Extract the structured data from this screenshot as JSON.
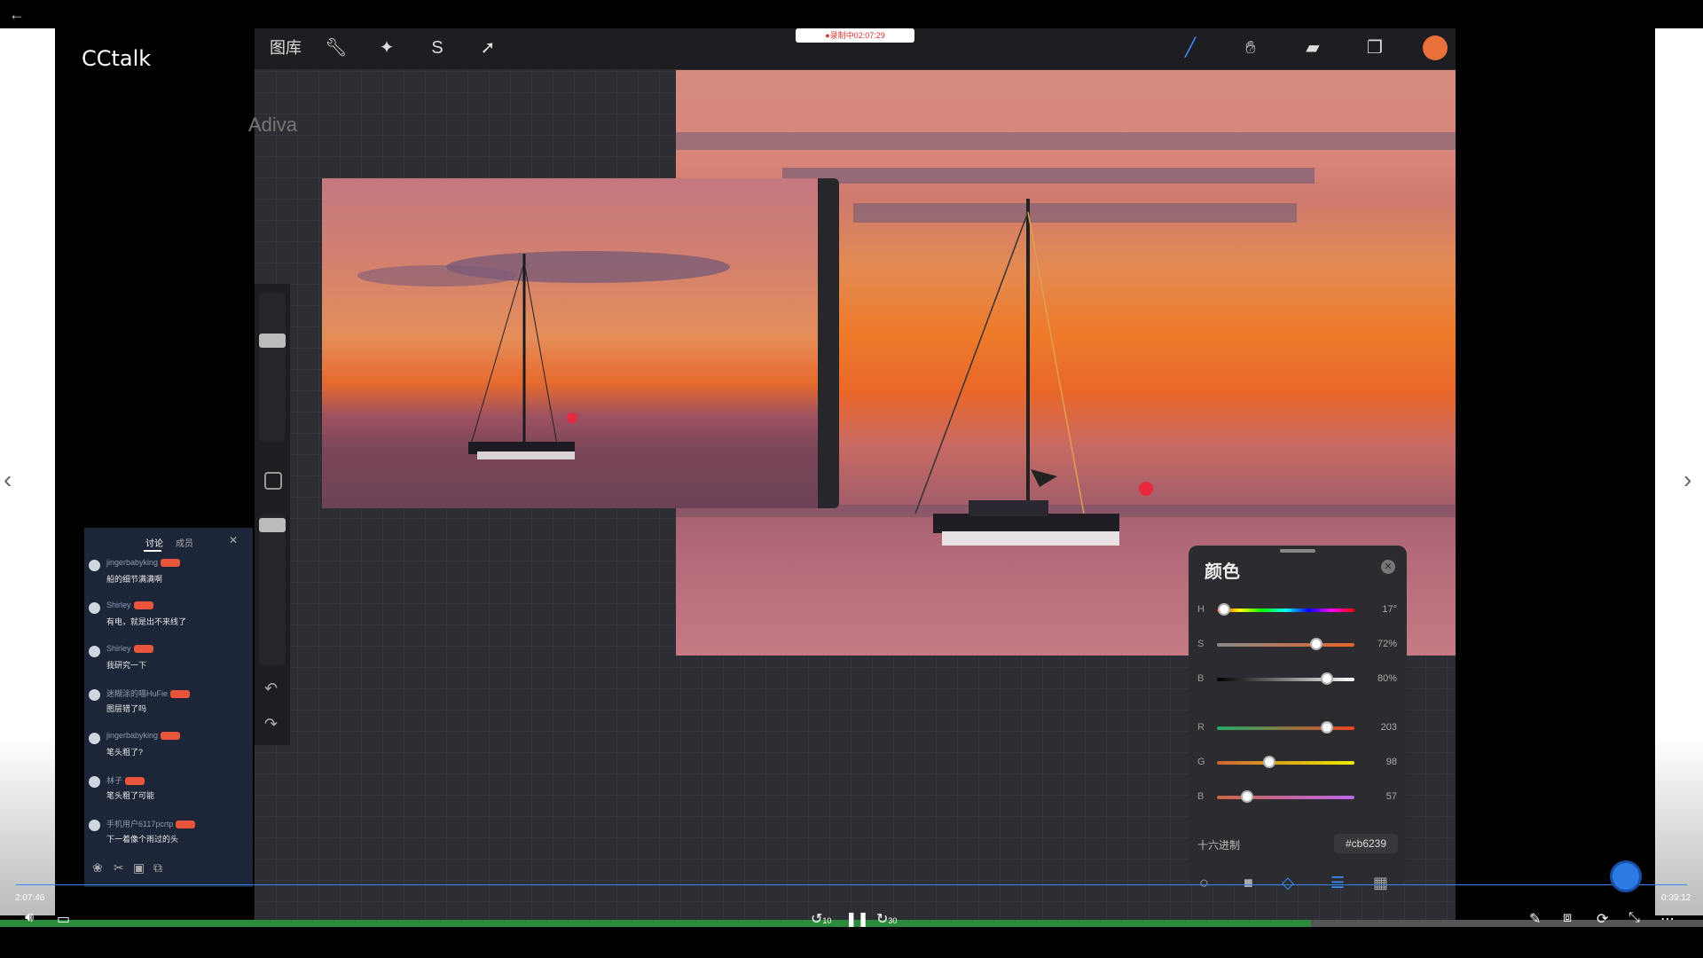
{
  "player": {
    "brand": "CCtalk",
    "watermark": "Adiva",
    "time_elapsed": "2:07:46",
    "time_total": "0:39:12",
    "progress": 0.77,
    "recording_badge": "●录制中02:07:29"
  },
  "procreate": {
    "gallery_label": "图库",
    "swatch_color": "#e8703a"
  },
  "chat": {
    "tabs": [
      "讨论",
      "成员"
    ],
    "messages": [
      {
        "user": "jingerbabyking",
        "text": "船的细节满满啊"
      },
      {
        "user": "Shirley",
        "text": "有电，就是出不来线了"
      },
      {
        "user": "Shirley",
        "text": "我研究一下"
      },
      {
        "user": "迷糊涂的喵HuFie",
        "text": "图层错了吗"
      },
      {
        "user": "jingerbabyking",
        "text": "笔头粗了?"
      },
      {
        "user": "林子",
        "text": "笔头粗了可能"
      },
      {
        "user": "手机用户6117pcrtp",
        "text": "下一着像个雨过的头"
      }
    ]
  },
  "color_panel": {
    "title": "颜色",
    "sliders": [
      {
        "label": "H",
        "value": "17°",
        "pos": 0.05
      },
      {
        "label": "S",
        "value": "72%",
        "pos": 0.72
      },
      {
        "label": "B",
        "value": "80%",
        "pos": 0.8
      },
      {
        "label": "R",
        "value": "203",
        "pos": 0.8
      },
      {
        "label": "G",
        "value": "98",
        "pos": 0.38
      },
      {
        "label": "B",
        "value": "57",
        "pos": 0.22
      }
    ],
    "hex_label": "十六进制",
    "hex_value": "#cb6239"
  },
  "controls": {
    "skip_back": "10",
    "skip_forward": "30"
  }
}
